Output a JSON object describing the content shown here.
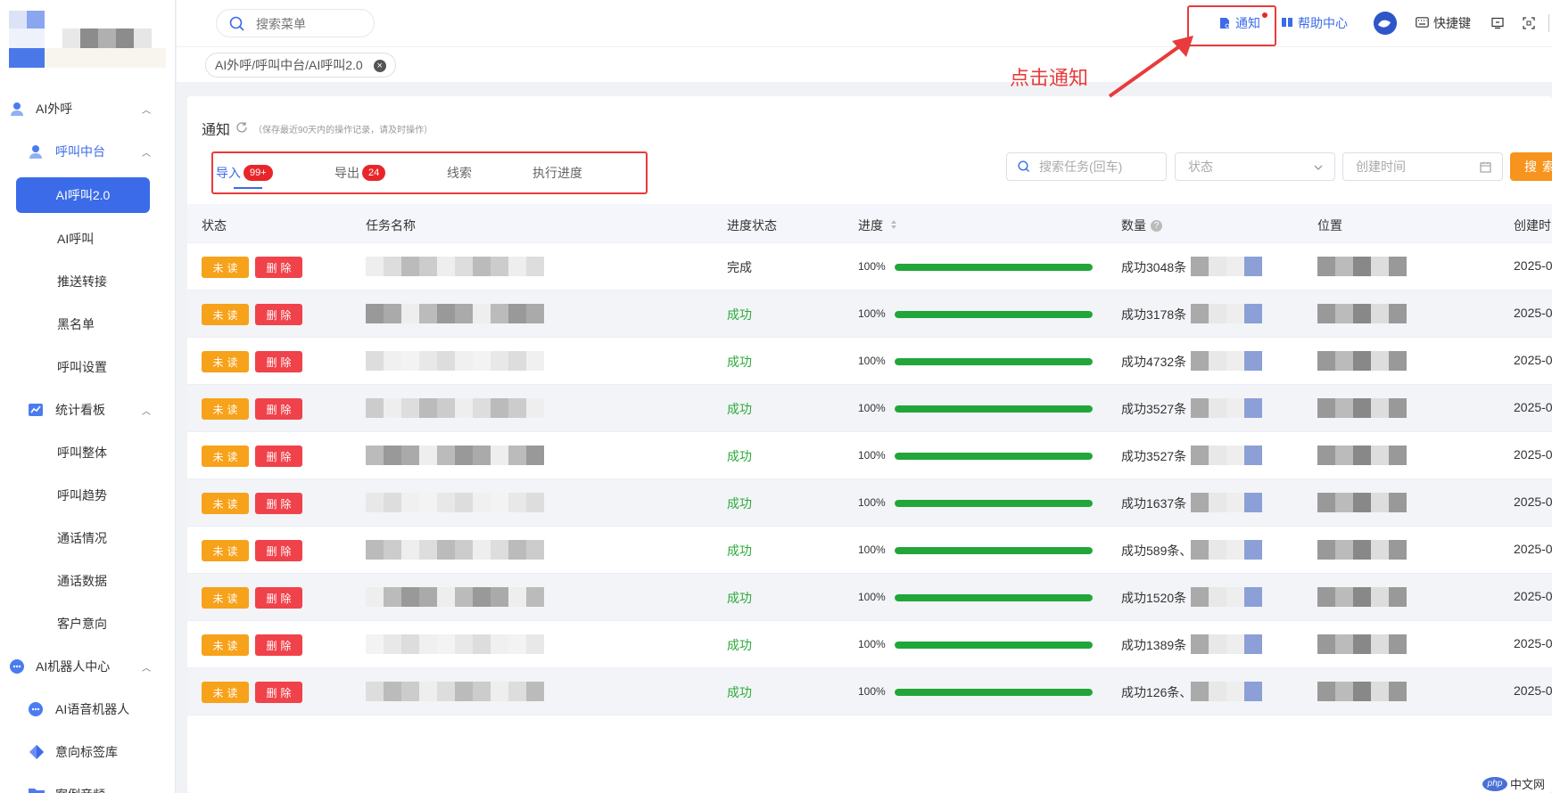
{
  "sidebar": {
    "groups": [
      {
        "label": "AI外呼"
      },
      {
        "label": "呼叫中台"
      },
      {
        "label": "统计看板"
      },
      {
        "label": "AI机器人中心"
      }
    ],
    "active_item": "AI呼叫2.0",
    "items_call": [
      "AI呼叫",
      "推送转接",
      "黑名单",
      "呼叫设置"
    ],
    "items_stats": [
      "呼叫整体",
      "呼叫趋势",
      "通话情况",
      "通话数据",
      "客户意向"
    ],
    "items_robot": [
      "AI语音机器人",
      "意向标签库",
      "案例音频"
    ],
    "colors": {
      "active_bg": "#3b6be8",
      "icon_blue": "#4a7cf0"
    }
  },
  "topbar": {
    "search_placeholder": "搜索菜单",
    "notify_label": "通知",
    "help_label": "帮助中心",
    "shortcut_label": "快捷键"
  },
  "breadcrumb_tag": "AI外呼/呼叫中台/AI呼叫2.0",
  "page": {
    "title": "通知",
    "subtitle": "（保存最近90天内的操作记录，请及时操作）",
    "tabs": [
      {
        "label": "导入",
        "badge": "99+"
      },
      {
        "label": "导出",
        "badge": "24"
      },
      {
        "label": "线索",
        "badge": ""
      },
      {
        "label": "执行进度",
        "badge": ""
      }
    ],
    "filters": {
      "task_search_placeholder": "搜索任务(回车)",
      "status_placeholder": "状态",
      "created_placeholder": "创建时间",
      "search_button": "搜索"
    }
  },
  "table": {
    "headers": [
      "状态",
      "任务名称",
      "进度状态",
      "进度",
      "数量",
      "位置",
      "创建时"
    ],
    "unread_label": "未读",
    "delete_label": "删除",
    "rows": [
      {
        "progress_state": "完成",
        "percent_label": "100%",
        "percent": 100,
        "qty": "成功3048条",
        "date": "2025-0"
      },
      {
        "progress_state": "成功",
        "percent_label": "100%",
        "percent": 100,
        "qty": "成功3178条",
        "date": "2025-0"
      },
      {
        "progress_state": "成功",
        "percent_label": "100%",
        "percent": 100,
        "qty": "成功4732条",
        "date": "2025-0"
      },
      {
        "progress_state": "成功",
        "percent_label": "100%",
        "percent": 100,
        "qty": "成功3527条",
        "date": "2025-0"
      },
      {
        "progress_state": "成功",
        "percent_label": "100%",
        "percent": 100,
        "qty": "成功3527条",
        "date": "2025-0"
      },
      {
        "progress_state": "成功",
        "percent_label": "100%",
        "percent": 100,
        "qty": "成功1637条",
        "date": "2025-0"
      },
      {
        "progress_state": "成功",
        "percent_label": "100%",
        "percent": 100,
        "qty": "成功589条、",
        "date": "2025-0"
      },
      {
        "progress_state": "成功",
        "percent_label": "100%",
        "percent": 100,
        "qty": "成功1520条",
        "date": "2025-0"
      },
      {
        "progress_state": "成功",
        "percent_label": "100%",
        "percent": 100,
        "qty": "成功1389条",
        "date": "2025-0"
      },
      {
        "progress_state": "成功",
        "percent_label": "100%",
        "percent": 100,
        "qty": "成功126条、",
        "date": "2025-0"
      }
    ]
  },
  "annotation": {
    "text": "点击通知",
    "color": "#e83b3b"
  },
  "watermark": {
    "badge": "php",
    "text": "中文网"
  }
}
